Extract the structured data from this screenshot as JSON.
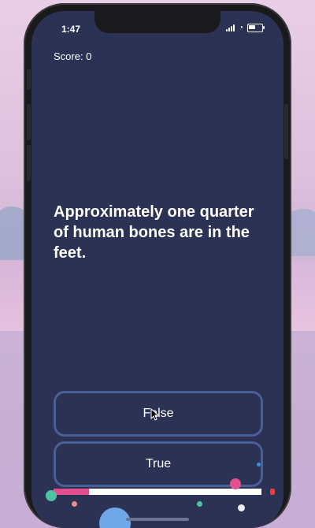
{
  "status_bar": {
    "time": "1:47"
  },
  "game": {
    "score_text": "Score: 0",
    "question": "Approximately one quarter of human bones are in the feet.",
    "answers": {
      "false_label": "False",
      "true_label": "True"
    },
    "progress": 0.17
  },
  "colors": {
    "screen_bg": "#2c3254",
    "button_border": "#4a5f96",
    "progress_fill": "#e0508e",
    "progress_track": "#ffffff"
  },
  "icons": [
    "signal-icon",
    "wifi-icon",
    "battery-icon",
    "cursor-icon"
  ]
}
